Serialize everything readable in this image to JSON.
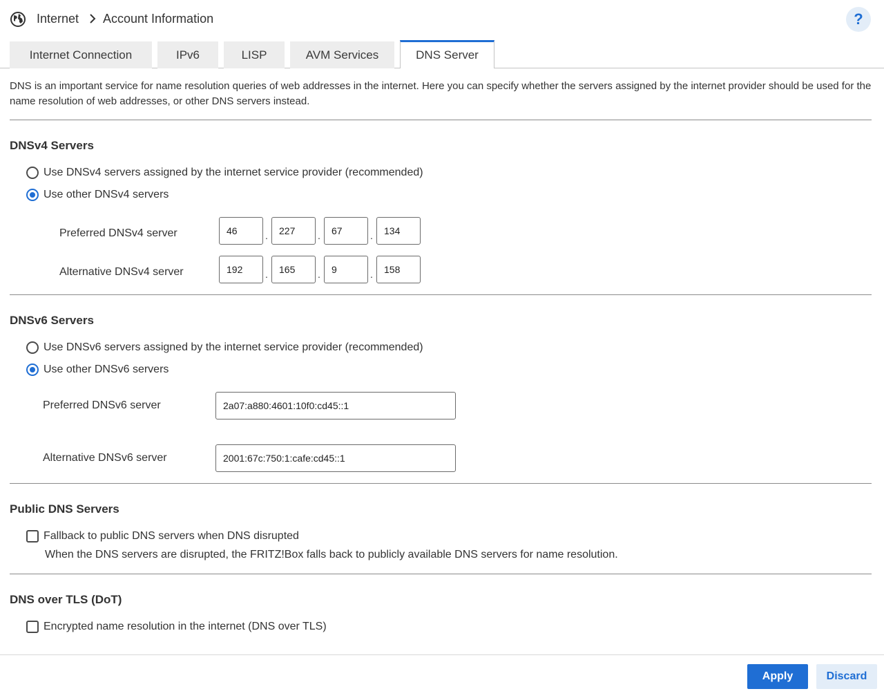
{
  "breadcrumb": {
    "root": "Internet",
    "current": "Account Information"
  },
  "help": {
    "label": "?"
  },
  "tabs": [
    {
      "label": "Internet Connection",
      "active": false
    },
    {
      "label": "IPv6",
      "active": false
    },
    {
      "label": "LISP",
      "active": false
    },
    {
      "label": "AVM Services",
      "active": false
    },
    {
      "label": "DNS Server",
      "active": true
    }
  ],
  "intro": "DNS is an important service for name resolution queries of web addresses in the internet. Here you can specify whether the servers assigned by the internet provider should be used for the name resolution of web addresses, or other DNS servers instead.",
  "dnsv4": {
    "title": "DNSv4 Servers",
    "option_isp": "Use DNSv4 servers assigned by the internet service provider (recommended)",
    "option_other": "Use other DNSv4 servers",
    "selected": "other",
    "preferred_label": "Preferred DNSv4 server",
    "preferred": [
      "46",
      "227",
      "67",
      "134"
    ],
    "alternative_label": "Alternative DNSv4 server",
    "alternative": [
      "192",
      "165",
      "9",
      "158"
    ]
  },
  "dnsv6": {
    "title": "DNSv6 Servers",
    "option_isp": "Use DNSv6 servers assigned by the internet service provider (recommended)",
    "option_other": "Use other DNSv6 servers",
    "selected": "other",
    "preferred_label": "Preferred DNSv6 server",
    "preferred": "2a07:a880:4601:10f0:cd45::1",
    "alternative_label": "Alternative DNSv6 server",
    "alternative": "2001:67c:750:1:cafe:cd45::1"
  },
  "public_dns": {
    "title": "Public DNS Servers",
    "option": "Fallback to public DNS servers when DNS disrupted",
    "checked": false,
    "hint": "When the DNS servers are disrupted, the FRITZ!Box falls back to publicly available DNS servers for name resolution."
  },
  "dot": {
    "title": "DNS over TLS (DoT)",
    "option": "Encrypted name resolution in the internet (DNS over TLS)",
    "checked": false
  },
  "buttons": {
    "apply": "Apply",
    "discard": "Discard"
  },
  "colors": {
    "accent": "#1f6ed4",
    "accent_light": "#e3edf8",
    "tab_inactive": "#ededed"
  }
}
